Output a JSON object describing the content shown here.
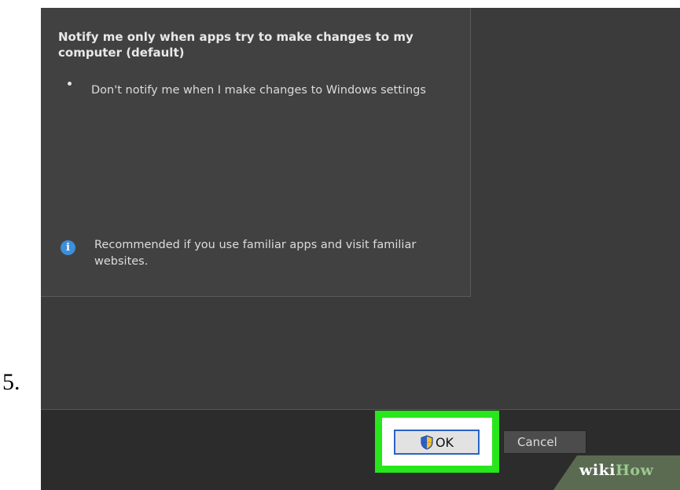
{
  "step": {
    "number": "5."
  },
  "dialog": {
    "heading": "Notify me only when apps try to make changes to my computer (default)",
    "bullet": "Don't notify me when I make changes to Windows settings",
    "info_icon": "info-icon",
    "info": "Recommended if you use familiar apps and visit familiar websites."
  },
  "buttons": {
    "ok_label": "OK",
    "ok_icon": "uac-shield-icon",
    "cancel_label": "Cancel"
  },
  "watermark": {
    "wiki": "wiki",
    "how": "How"
  },
  "colors": {
    "highlight": "#27e61b",
    "ok_border": "#2a63c4",
    "info_icon": "#3e8ed8",
    "dialog_background": "#414141"
  }
}
